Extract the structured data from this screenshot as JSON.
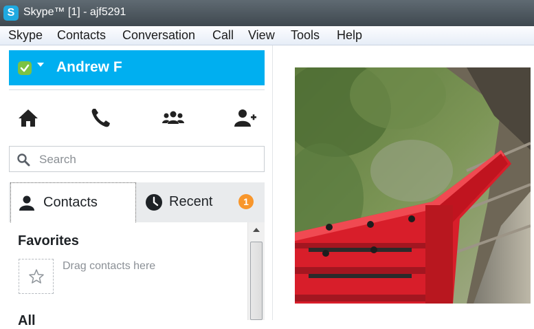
{
  "window": {
    "title": "Skype™ [1] - ajf5291",
    "logo_letter": "S"
  },
  "menu": [
    "Skype",
    "Contacts",
    "Conversation",
    "Call",
    "View",
    "Tools",
    "Help"
  ],
  "profile": {
    "name": "Andrew F",
    "status": "online"
  },
  "nav_icons": [
    "home-icon",
    "phone-icon",
    "group-icon",
    "add-contact-icon"
  ],
  "search": {
    "placeholder": "Search"
  },
  "tabs": {
    "contacts": {
      "label": "Contacts",
      "icon": "person-icon"
    },
    "recent": {
      "label": "Recent",
      "icon": "clock-icon",
      "badge": "1"
    }
  },
  "list": {
    "favorites_title": "Favorites",
    "favorites_hint": "Drag contacts here",
    "all_title": "All"
  },
  "colors": {
    "profile_bar": "#00aff0",
    "status_green": "#7cc243",
    "badge": "#f8962b"
  },
  "main": {
    "image_subject": "red roller coaster train photo"
  }
}
